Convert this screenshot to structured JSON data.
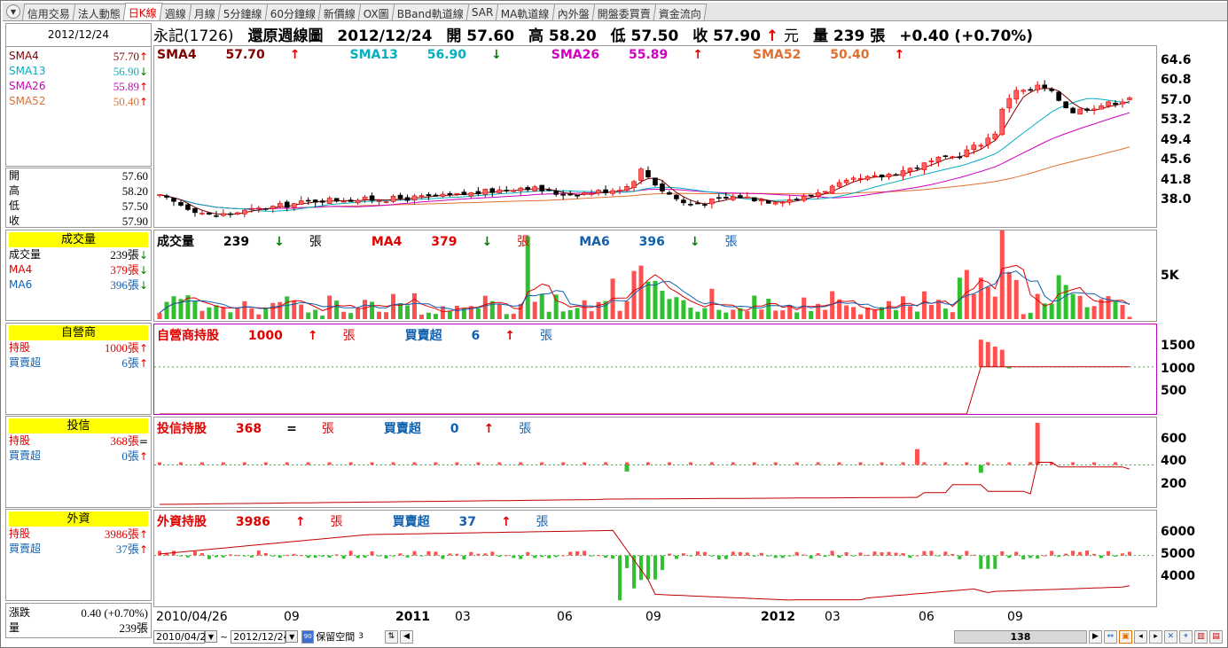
{
  "tabs": [
    "信用交易",
    "法人動態",
    "日K線",
    "週線",
    "月線",
    "5分鐘線",
    "60分鐘線",
    "新價線",
    "OX圖",
    "BBand軌道線",
    "SAR",
    "MA軌道線",
    "內外盤",
    "開盤委買賣",
    "資金流向"
  ],
  "active_tab": 2,
  "left": {
    "date": "2012/12/24",
    "sma": [
      {
        "name": "SMA4",
        "value": "57.70",
        "dir": "↑"
      },
      {
        "name": "SMA13",
        "value": "56.90",
        "dir": "↓"
      },
      {
        "name": "SMA26",
        "value": "55.89",
        "dir": "↑"
      },
      {
        "name": "SMA52",
        "value": "50.40",
        "dir": "↑"
      }
    ],
    "ohlc": [
      {
        "label": "開",
        "value": "57.60"
      },
      {
        "label": "高",
        "value": "58.20"
      },
      {
        "label": "低",
        "value": "57.50"
      },
      {
        "label": "收",
        "value": "57.90"
      }
    ],
    "volume_title": "成交量",
    "volume": [
      {
        "label": "成交量",
        "value": "239張",
        "dir": "↓"
      },
      {
        "label": "MA4",
        "value": "379張",
        "dir": "↓"
      },
      {
        "label": "MA6",
        "value": "396張",
        "dir": "↓"
      }
    ],
    "dealer_title": "自營商",
    "dealer": [
      {
        "label": "持股",
        "value": "1000張",
        "dir": "↑"
      },
      {
        "label": "買賣超",
        "value": "6張",
        "dir": "↑"
      }
    ],
    "trust_title": "投信",
    "trust": [
      {
        "label": "持股",
        "value": "368張",
        "dir": "="
      },
      {
        "label": "買賣超",
        "value": "0張",
        "dir": "↑"
      }
    ],
    "foreign_title": "外資",
    "foreign": [
      {
        "label": "持股",
        "value": "3986張",
        "dir": "↑"
      },
      {
        "label": "買賣超",
        "value": "37張",
        "dir": "↑"
      }
    ],
    "change_label": "漲跌",
    "change_value": "0.40 (+0.70%)",
    "vol_label": "量",
    "vol_value": "239張"
  },
  "title": {
    "name": "永記(1726)",
    "chart": "還原週線圖",
    "date": "2012/12/24",
    "open_label": "開",
    "open": "57.60",
    "high_label": "高",
    "high": "58.20",
    "low_label": "低",
    "low": "57.50",
    "close_label": "收",
    "close": "57.90",
    "arrow": "↑",
    "unit": "元",
    "vol_label": "量",
    "vol": "239",
    "vol_unit": "張",
    "change": "+0.40 (+0.70%)"
  },
  "price_legend": [
    {
      "name": "SMA4",
      "value": "57.70",
      "dir": "↑",
      "color": "#800000"
    },
    {
      "name": "SMA13",
      "value": "56.90",
      "dir": "↓",
      "color": "#00b0c0"
    },
    {
      "name": "SMA26",
      "value": "55.89",
      "dir": "↑",
      "color": "#d000c0"
    },
    {
      "name": "SMA52",
      "value": "50.40",
      "dir": "↑",
      "color": "#e07030"
    }
  ],
  "vol_legend": [
    {
      "name": "成交量",
      "value": "239",
      "dir": "↓",
      "unit": "張"
    },
    {
      "name": "MA4",
      "value": "379",
      "dir": "↓",
      "unit": "張"
    },
    {
      "name": "MA6",
      "value": "396",
      "dir": "↓",
      "unit": "張"
    }
  ],
  "dealer_legend": [
    {
      "name": "自營商持股",
      "value": "1000",
      "dir": "↑",
      "unit": "張"
    },
    {
      "name": "買賣超",
      "value": "6",
      "dir": "↑",
      "unit": "張"
    }
  ],
  "trust_legend": [
    {
      "name": "投信持股",
      "value": "368",
      "dir": "=",
      "unit": "張"
    },
    {
      "name": "買賣超",
      "value": "0",
      "dir": "↑",
      "unit": "張"
    }
  ],
  "foreign_legend": [
    {
      "name": "外資持股",
      "value": "3986",
      "dir": "↑",
      "unit": "張"
    },
    {
      "name": "買賣超",
      "value": "37",
      "dir": "↑",
      "unit": "張"
    }
  ],
  "price_ticks": [
    "64.6",
    "60.8",
    "57.0",
    "53.2",
    "49.4",
    "45.6",
    "41.8",
    "38.0"
  ],
  "vol_ticks": [
    "5K"
  ],
  "dealer_ticks": [
    "1500",
    "1000",
    "500"
  ],
  "trust_ticks": [
    "600",
    "400",
    "200"
  ],
  "foreign_ticks": [
    "6000",
    "5000",
    "4000"
  ],
  "x_labels": [
    "2010/04/26",
    "09",
    "2011",
    "03",
    "06",
    "09",
    "2012",
    "03",
    "06",
    "09"
  ],
  "bottom": {
    "from": "2010/04/26",
    "tilde": "~",
    "to": "2012/12/24",
    "keep_label": "保留空間",
    "keep_value": "3",
    "count": "138"
  },
  "chart_data": {
    "type": "candlestick",
    "title": "永記(1726) 還原週線圖",
    "weeks": 138,
    "x_range": [
      "2010/04/26",
      "2012/12/24"
    ],
    "price_ylim": [
      36.5,
      66.5
    ],
    "price_points": [
      [
        0,
        41.5
      ],
      [
        8,
        38.3
      ],
      [
        15,
        39.4
      ],
      [
        25,
        41.0
      ],
      [
        35,
        41.1
      ],
      [
        45,
        41.6
      ],
      [
        52,
        42.5
      ],
      [
        57,
        43.2
      ],
      [
        62,
        42.0
      ],
      [
        67,
        42.2
      ],
      [
        70,
        42.6
      ],
      [
        73,
        43.3
      ],
      [
        75,
        46.0
      ],
      [
        78,
        42.8
      ],
      [
        82,
        40.2
      ],
      [
        85,
        40.6
      ],
      [
        90,
        41.6
      ],
      [
        95,
        40.8
      ],
      [
        100,
        41.3
      ],
      [
        103,
        42.5
      ],
      [
        108,
        44.2
      ],
      [
        112,
        44.8
      ],
      [
        118,
        46.5
      ],
      [
        121,
        47.6
      ],
      [
        124,
        48.2
      ],
      [
        128,
        50.5
      ],
      [
        130,
        52.0
      ],
      [
        131,
        55.5
      ],
      [
        133,
        59.5
      ],
      [
        135,
        58.8
      ],
      [
        137,
        60.0
      ],
      [
        139,
        58.6
      ],
      [
        142,
        55.6
      ],
      [
        145,
        56.4
      ],
      [
        148,
        57.0
      ],
      [
        151,
        57.9
      ]
    ],
    "volume_ylim": [
      0,
      9200
    ],
    "dealer_holding_ylim": [
      0,
      1900
    ],
    "trust_holding_ylim": [
      80,
      760
    ],
    "foreign_holding_ylim": [
      3300,
      6500
    ],
    "last": {
      "open": 57.6,
      "high": 58.2,
      "low": 57.5,
      "close": 57.9,
      "volume": 239,
      "sma4": 57.7,
      "sma13": 56.9,
      "sma26": 55.89,
      "sma52": 50.4,
      "dealer": 1000,
      "trust": 368,
      "foreign": 3986
    }
  }
}
